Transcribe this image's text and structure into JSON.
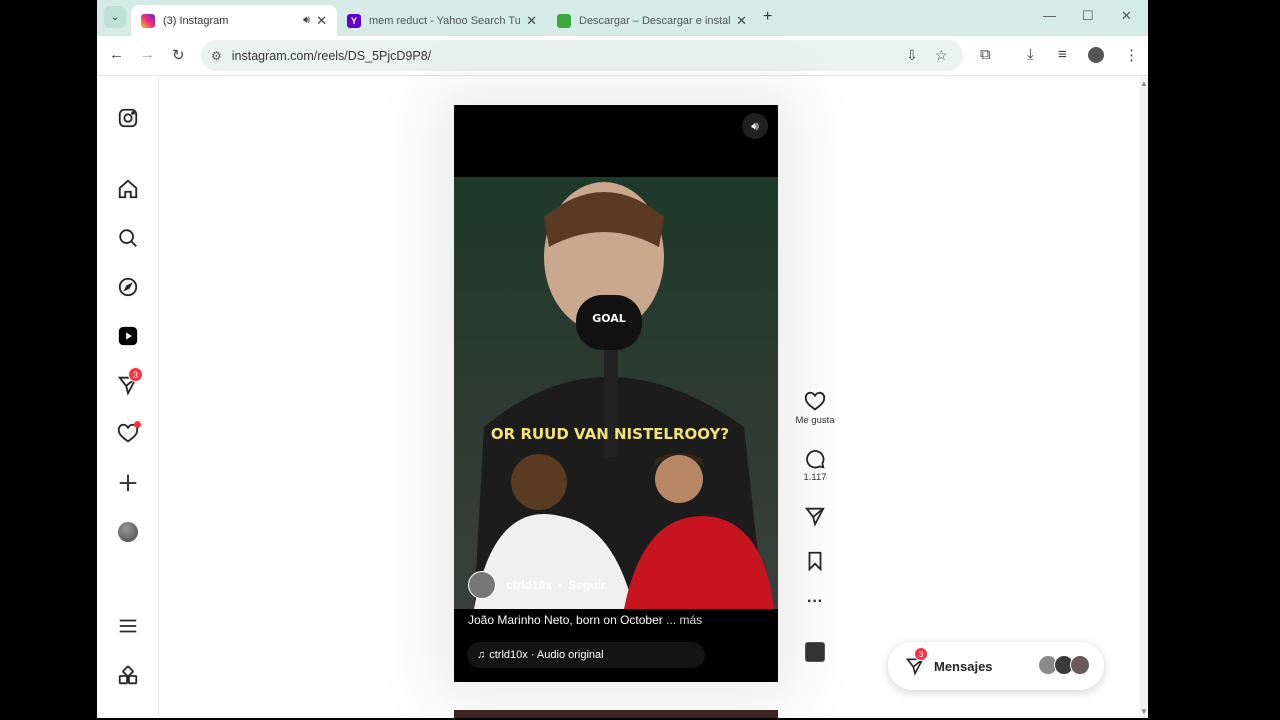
{
  "browser": {
    "tabs": [
      {
        "title": "(3) Instagram",
        "favicon_color": "#d6249f",
        "active": true
      },
      {
        "title": "mem reduct - Yahoo Search Tu",
        "favicon_color": "#6001d2",
        "active": false
      },
      {
        "title": "Descargar – Descargar e instala",
        "favicon_color": "#3ca83c",
        "active": false
      }
    ],
    "url": "instagram.com/reels/DS_5PjcD9P8/"
  },
  "sidebar": {
    "messages_badge": "3"
  },
  "reel": {
    "author": "ctrld10x",
    "follow_label": "Seguir",
    "caption": "João Marinho Neto, born on October",
    "more_label": "... más",
    "audio": "ctrld10x · Audio original",
    "overlay_text": "OR RUUD VAN NISTELROOY?"
  },
  "actions": {
    "like_label": "Me gusta",
    "comments_count": "1.117"
  },
  "messages": {
    "label": "Mensajes",
    "badge": "3"
  },
  "colors": {
    "tabstrip": "#d4ece5",
    "notification": "#ff3040"
  }
}
